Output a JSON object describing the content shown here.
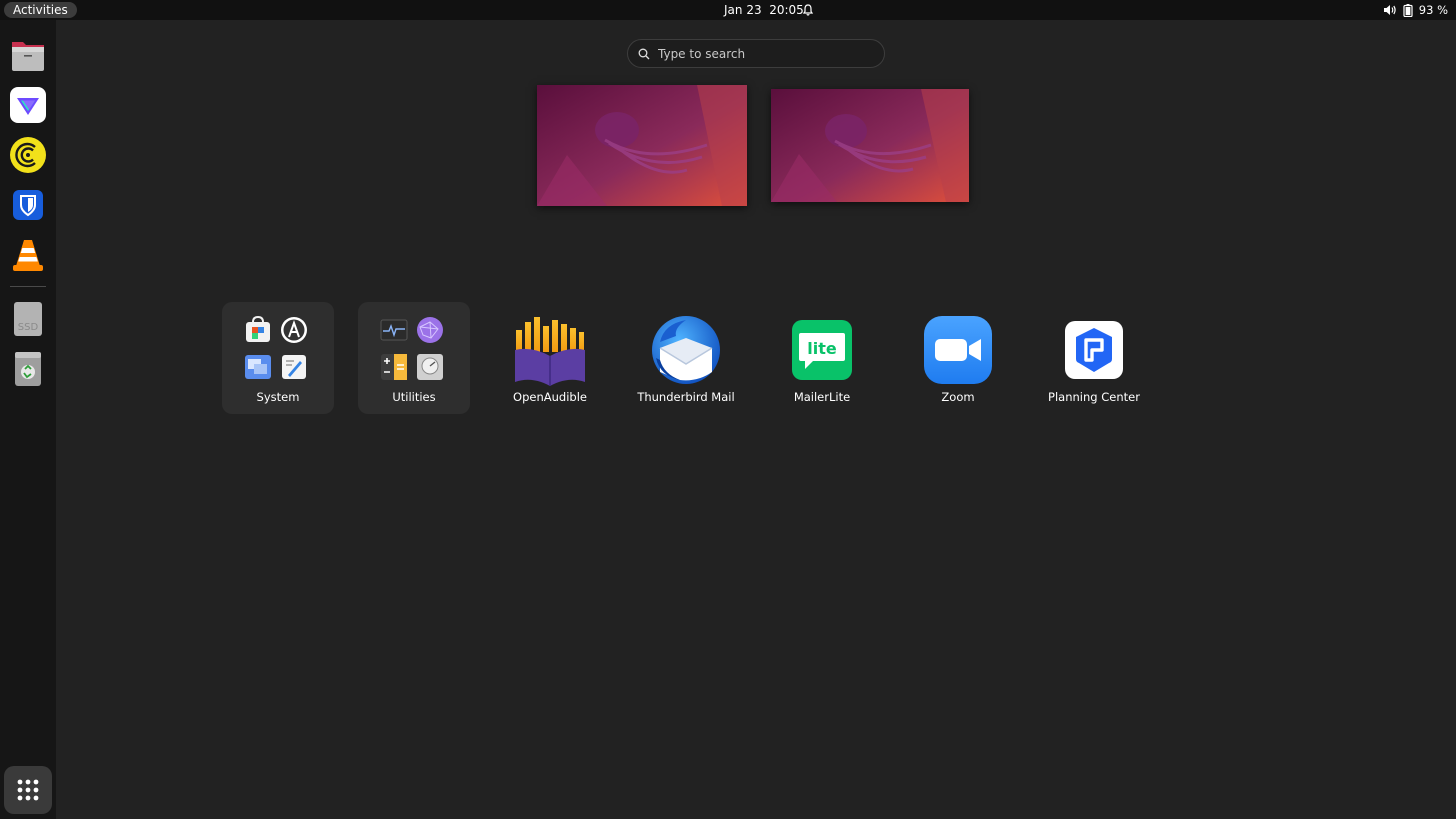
{
  "topbar": {
    "activities_label": "Activities",
    "clock": "Jan 23  20:05",
    "battery": "93 %",
    "icons": [
      "notification-bell-icon",
      "volume-icon",
      "battery-icon"
    ]
  },
  "dock": {
    "items": [
      {
        "name": "files",
        "icon": "folder-icon"
      },
      {
        "name": "proton-vpn",
        "icon": "proton-vpn-icon"
      },
      {
        "name": "coinbase",
        "icon": "coin-icon"
      },
      {
        "name": "bitwarden",
        "icon": "bitwarden-shield-icon"
      },
      {
        "name": "vlc",
        "icon": "vlc-cone-icon"
      },
      {
        "name": "ssd-drive",
        "icon": "drive-icon",
        "label": "SSD"
      },
      {
        "name": "trash",
        "icon": "trash-icon"
      }
    ],
    "show_apps_icon": "app-grid-icon"
  },
  "search": {
    "placeholder": "Type to search"
  },
  "apps": [
    {
      "label": "System",
      "type": "folder"
    },
    {
      "label": "Utilities",
      "type": "folder"
    },
    {
      "label": "OpenAudible",
      "icon": "openaudible-icon"
    },
    {
      "label": "Thunderbird Mail",
      "icon": "thunderbird-icon"
    },
    {
      "label": "MailerLite",
      "icon": "mailerlite-icon",
      "icon_text": "lite"
    },
    {
      "label": "Zoom",
      "icon": "zoom-camera-icon"
    },
    {
      "label": "Planning Center",
      "icon": "planning-center-icon"
    }
  ],
  "colors": {
    "background": "#222222",
    "topbar": "#111111",
    "dock": "#161616",
    "mailerlite_green": "#09c269",
    "zoom_blue": "#2d8cff",
    "planning_center_blue": "#2266f5"
  }
}
